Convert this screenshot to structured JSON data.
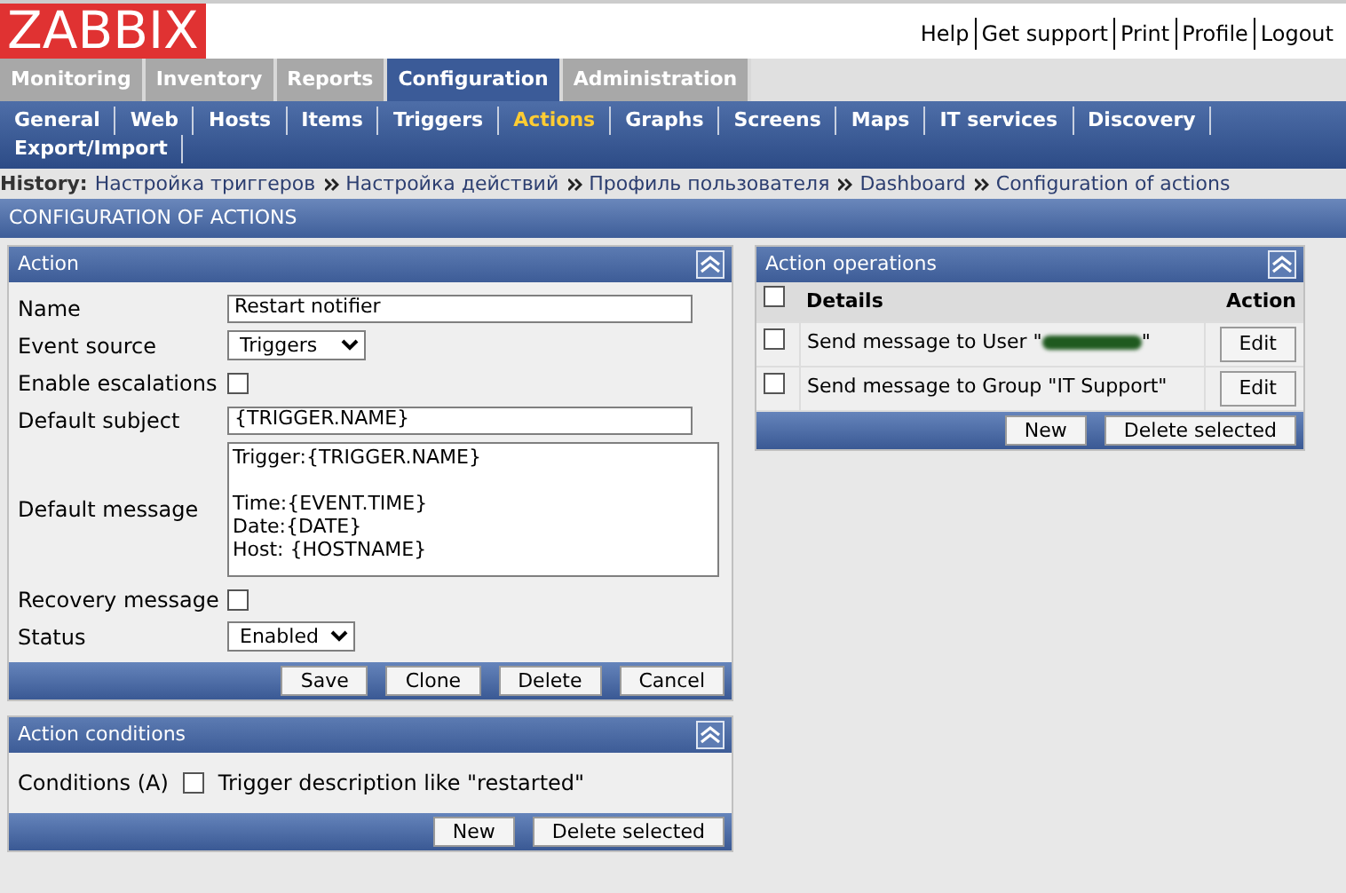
{
  "header": {
    "logo": "ZABBIX",
    "links": [
      "Help",
      "Get support",
      "Print",
      "Profile",
      "Logout"
    ]
  },
  "main_tabs": [
    {
      "label": "Monitoring",
      "selected": false
    },
    {
      "label": "Inventory",
      "selected": false
    },
    {
      "label": "Reports",
      "selected": false
    },
    {
      "label": "Configuration",
      "selected": true
    },
    {
      "label": "Administration",
      "selected": false
    }
  ],
  "sub_menu": [
    {
      "label": "General",
      "selected": false
    },
    {
      "label": "Web",
      "selected": false
    },
    {
      "label": "Hosts",
      "selected": false
    },
    {
      "label": "Items",
      "selected": false
    },
    {
      "label": "Triggers",
      "selected": false
    },
    {
      "label": "Actions",
      "selected": true
    },
    {
      "label": "Graphs",
      "selected": false
    },
    {
      "label": "Screens",
      "selected": false
    },
    {
      "label": "Maps",
      "selected": false
    },
    {
      "label": "IT services",
      "selected": false
    },
    {
      "label": "Discovery",
      "selected": false
    },
    {
      "label": "Export/Import",
      "selected": false
    }
  ],
  "history": {
    "label": "History:",
    "items": [
      "Настройка триггеров",
      "Настройка действий",
      "Профиль пользователя",
      "Dashboard",
      "Configuration of actions"
    ]
  },
  "page_title": "CONFIGURATION OF ACTIONS",
  "action_panel": {
    "title": "Action",
    "fields": [
      {
        "kind": "text",
        "label": "Name",
        "value": "Restart notifier"
      },
      {
        "kind": "select",
        "label": "Event source",
        "value": "Triggers"
      },
      {
        "kind": "checkbox",
        "label": "Enable escalations",
        "checked": false
      },
      {
        "kind": "text",
        "label": "Default subject",
        "value": "{TRIGGER.NAME}"
      },
      {
        "kind": "textarea",
        "label": "Default message",
        "value": "Trigger:{TRIGGER.NAME}\n\nTime:{EVENT.TIME}\nDate:{DATE}\nHost: {HOSTNAME}"
      },
      {
        "kind": "checkbox",
        "label": "Recovery message",
        "checked": false
      },
      {
        "kind": "select",
        "label": "Status",
        "value": "Enabled"
      }
    ],
    "buttons": [
      "Save",
      "Clone",
      "Delete",
      "Cancel"
    ]
  },
  "conditions_panel": {
    "title": "Action conditions",
    "label": "Conditions (A)",
    "conditions": [
      {
        "text": "Trigger description like \"restarted\"",
        "checked": false
      }
    ],
    "buttons": [
      "New",
      "Delete selected"
    ]
  },
  "operations_panel": {
    "title": "Action operations",
    "all_checked": false,
    "columns": [
      "Details",
      "Action"
    ],
    "rows": [
      {
        "checked": false,
        "details": "Send message to User \"",
        "redacted": true,
        "details_end": "\"",
        "button": "Edit"
      },
      {
        "checked": false,
        "details": "Send message to Group \"IT Support\"",
        "redacted": false,
        "button": "Edit"
      }
    ],
    "buttons": [
      "New",
      "Delete selected"
    ]
  }
}
